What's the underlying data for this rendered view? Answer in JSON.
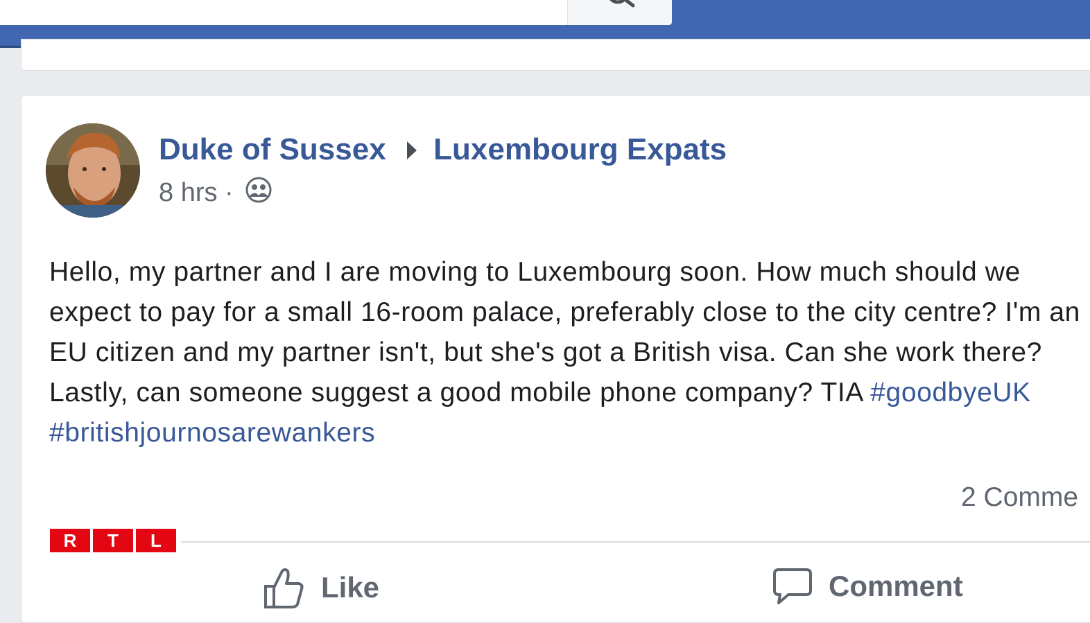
{
  "colors": {
    "nav_blue": "#4267b2",
    "link_blue": "#385898",
    "text": "#1c1e21",
    "muted": "#616770",
    "rtl_red": "#e30613"
  },
  "topbar": {
    "search_icon": "search-icon"
  },
  "post": {
    "author": "Duke of Sussex",
    "group": "Luxembourg Expats",
    "time": "8 hrs",
    "separator": "·",
    "audience_icon": "group-audience-icon",
    "body_text": "Hello, my partner and I are moving to Luxembourg soon. How much should we expect to pay for a small 16-room palace, preferably close to the city centre? I'm an EU citizen and my partner isn't, but she's got a British visa. Can she work there? Lastly, can someone suggest a good mobile phone company? TIA ",
    "hashtags": [
      "#goodbyeUK",
      "#britishjournosarewankers"
    ],
    "comments_count": "2 Comme",
    "actions": {
      "like": "Like",
      "comment": "Comment"
    }
  },
  "watermark": {
    "letters": [
      "R",
      "T",
      "L"
    ]
  }
}
